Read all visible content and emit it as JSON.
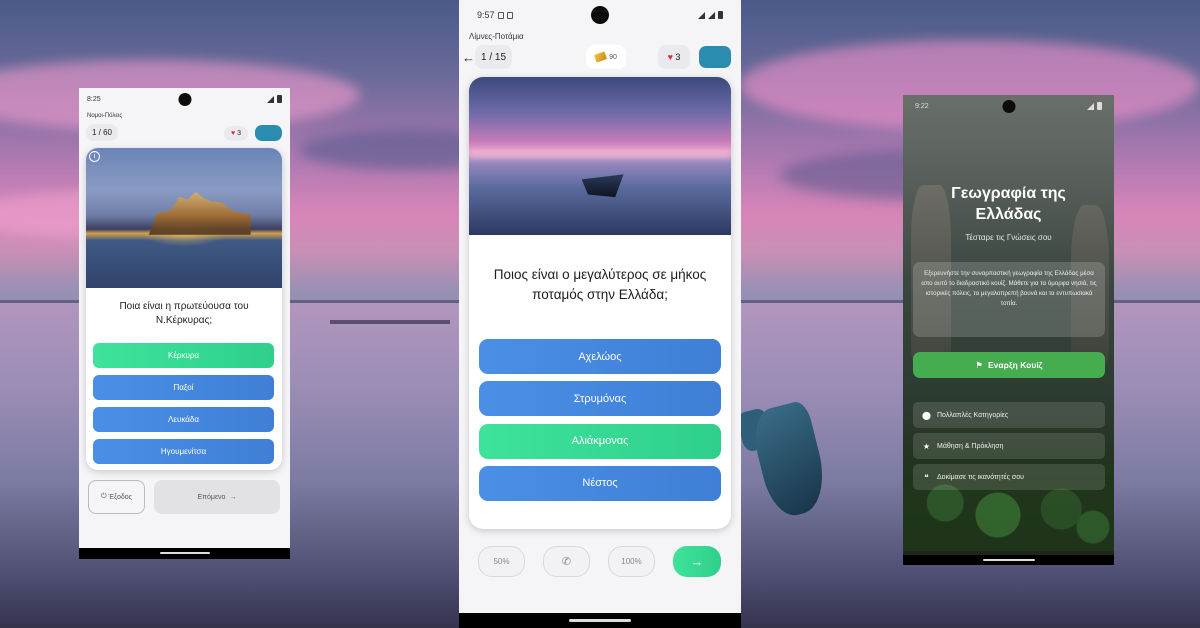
{
  "phone_left": {
    "status_time": "8:25",
    "category": "Νομοι-Πόλεις",
    "progress": "1 / 60",
    "lives": "3",
    "question": "Ποια είναι η πρωτεύουσα του Ν.Κέρκυρας;",
    "answers": [
      {
        "label": "Κέρκυρα",
        "correct": true
      },
      {
        "label": "Παξοί",
        "correct": false
      },
      {
        "label": "Λευκάδα",
        "correct": false
      },
      {
        "label": "Ηγουμενίτσα",
        "correct": false
      }
    ],
    "exit_label": "Έξοδος",
    "next_label": "Επόμενο"
  },
  "phone_center": {
    "status_time": "9:57",
    "category": "Λίμνες-Ποτάμια",
    "progress": "1 / 15",
    "coins": "90",
    "lives": "3",
    "question": "Ποιος είναι ο μεγαλύτερος σε μήκος ποταμός στην Ελλάδα;",
    "answers": [
      {
        "label": "Αχελώος",
        "correct": false
      },
      {
        "label": "Στρυμόνας",
        "correct": false
      },
      {
        "label": "Αλιάκμονας",
        "correct": true
      },
      {
        "label": "Νέστος",
        "correct": false
      }
    ],
    "lifelines": {
      "fifty": "50%",
      "hundred": "100%"
    }
  },
  "phone_right": {
    "status_time": "9:22",
    "title_line1": "Γεωγραφία της",
    "title_line2": "Ελλάδας",
    "subtitle": "Τέσταρε τις Γνώσεις σου",
    "description": "Εξερευνήστε την συναρπαστική γεωγραφία της Ελλάδας μέσα απο αυτό το διαδραστικό κουίζ. Μάθετε για τα όμορφα νησιά, τις ιστορικές πόλεις, τα μεγαλοπρεπή βουνά και τα εντυπωσιακά τοπία.",
    "start_button": "Εναρξη Κουίζ",
    "features": [
      "Πολλαπλές Κατηγορίες",
      "Μάθηση & Πρόκληση",
      "Δοκίμασε τις ικανότητές σου"
    ]
  },
  "colors": {
    "answer_blue": "#4a8fe6",
    "answer_correct": "#3ee39b",
    "start_green": "#45ac4f",
    "accent_teal": "#2a8db0"
  }
}
